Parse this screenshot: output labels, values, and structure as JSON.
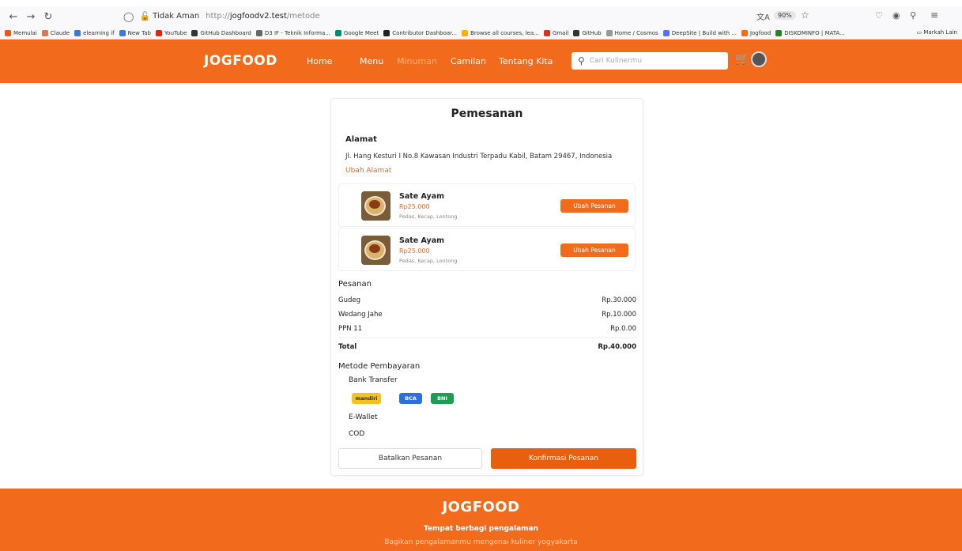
{
  "browser": {
    "security_label": "Tidak Aman",
    "url_prefix": "http://",
    "url_host": "jogfoodv2.test",
    "url_path": "/metode",
    "zoom": "90%",
    "bookmarks": [
      {
        "label": "Memulai",
        "color": "#e55a1c"
      },
      {
        "label": "Claude",
        "color": "#d97757"
      },
      {
        "label": "elearning if",
        "color": "#3a7bd5"
      },
      {
        "label": "New Tab",
        "color": "#3a7bd5"
      },
      {
        "label": "YouTube",
        "color": "#e62117"
      },
      {
        "label": "GitHub Dashboard",
        "color": "#333333"
      },
      {
        "label": "D3 IF - Teknik Informa...",
        "color": "#666666"
      },
      {
        "label": "Google Meet",
        "color": "#00897b"
      },
      {
        "label": "Contributor Dashboar...",
        "color": "#222222"
      },
      {
        "label": "Browse all courses, lea...",
        "color": "#f4b400"
      },
      {
        "label": "Gmail",
        "color": "#d93025"
      },
      {
        "label": "GitHub",
        "color": "#333333"
      },
      {
        "label": "Home / Cosmos",
        "color": "#999999"
      },
      {
        "label": "DeepSite | Build with ...",
        "color": "#5b6cff"
      },
      {
        "label": "Jogfood",
        "color": "#f26b1d"
      },
      {
        "label": "DISKOMINFO | MATA...",
        "color": "#2e7d32"
      }
    ],
    "bookmarks_other": "Markah Lain"
  },
  "header": {
    "logo": "JOGFOOD",
    "nav": {
      "home": "Home",
      "menu": "Menu",
      "minuman": "Minuman",
      "camilan": "Camilan",
      "tentang": "Tentang Kita"
    },
    "search_placeholder": "Cari Kulinermu"
  },
  "order": {
    "title": "Pemesanan",
    "address_heading": "Alamat",
    "address": "Jl. Hang Kesturi I No.8 Kawasan Industri Terpadu Kabil, Batam 29467, Indonesia",
    "change_address": "Ubah Alamat",
    "items": [
      {
        "name": "Sate Ayam",
        "price": "Rp25.000",
        "notes": "Pedas, Kecap, Lontong",
        "button": "Ubah Pesanan"
      },
      {
        "name": "Sate Ayam",
        "price": "Rp25.000",
        "notes": "Pedas, Kecap, Lontong",
        "button": "Ubah Pesanan"
      }
    ],
    "summary_heading": "Pesanan",
    "summary_rows": [
      {
        "label": "Gudeg",
        "value": "Rp.30.000"
      },
      {
        "label": "Wedang Jahe",
        "value": "Rp.10.000"
      },
      {
        "label": "PPN 11",
        "value": "Rp.0.00"
      }
    ],
    "total": {
      "label": "Total",
      "value": "Rp.40.000"
    },
    "payment_heading": "Metode Pembayaran",
    "bank_transfer": "Bank Transfer",
    "banks": [
      "mandiri",
      "BCA",
      "BNI"
    ],
    "ewallet": "E-Wallet",
    "cod": "COD",
    "cancel": "Batalkan Pesanan",
    "confirm": "Konfirmasi Pesanan"
  },
  "footer": {
    "logo": "JOGFOOD",
    "tagline": "Tempat berbagi pengalaman",
    "sub": "Bagikan pengalamanmu mengenai kuliner yogyakarta"
  },
  "colors": {
    "brand": "#f26b1d",
    "brand_dark": "#e85f10"
  }
}
